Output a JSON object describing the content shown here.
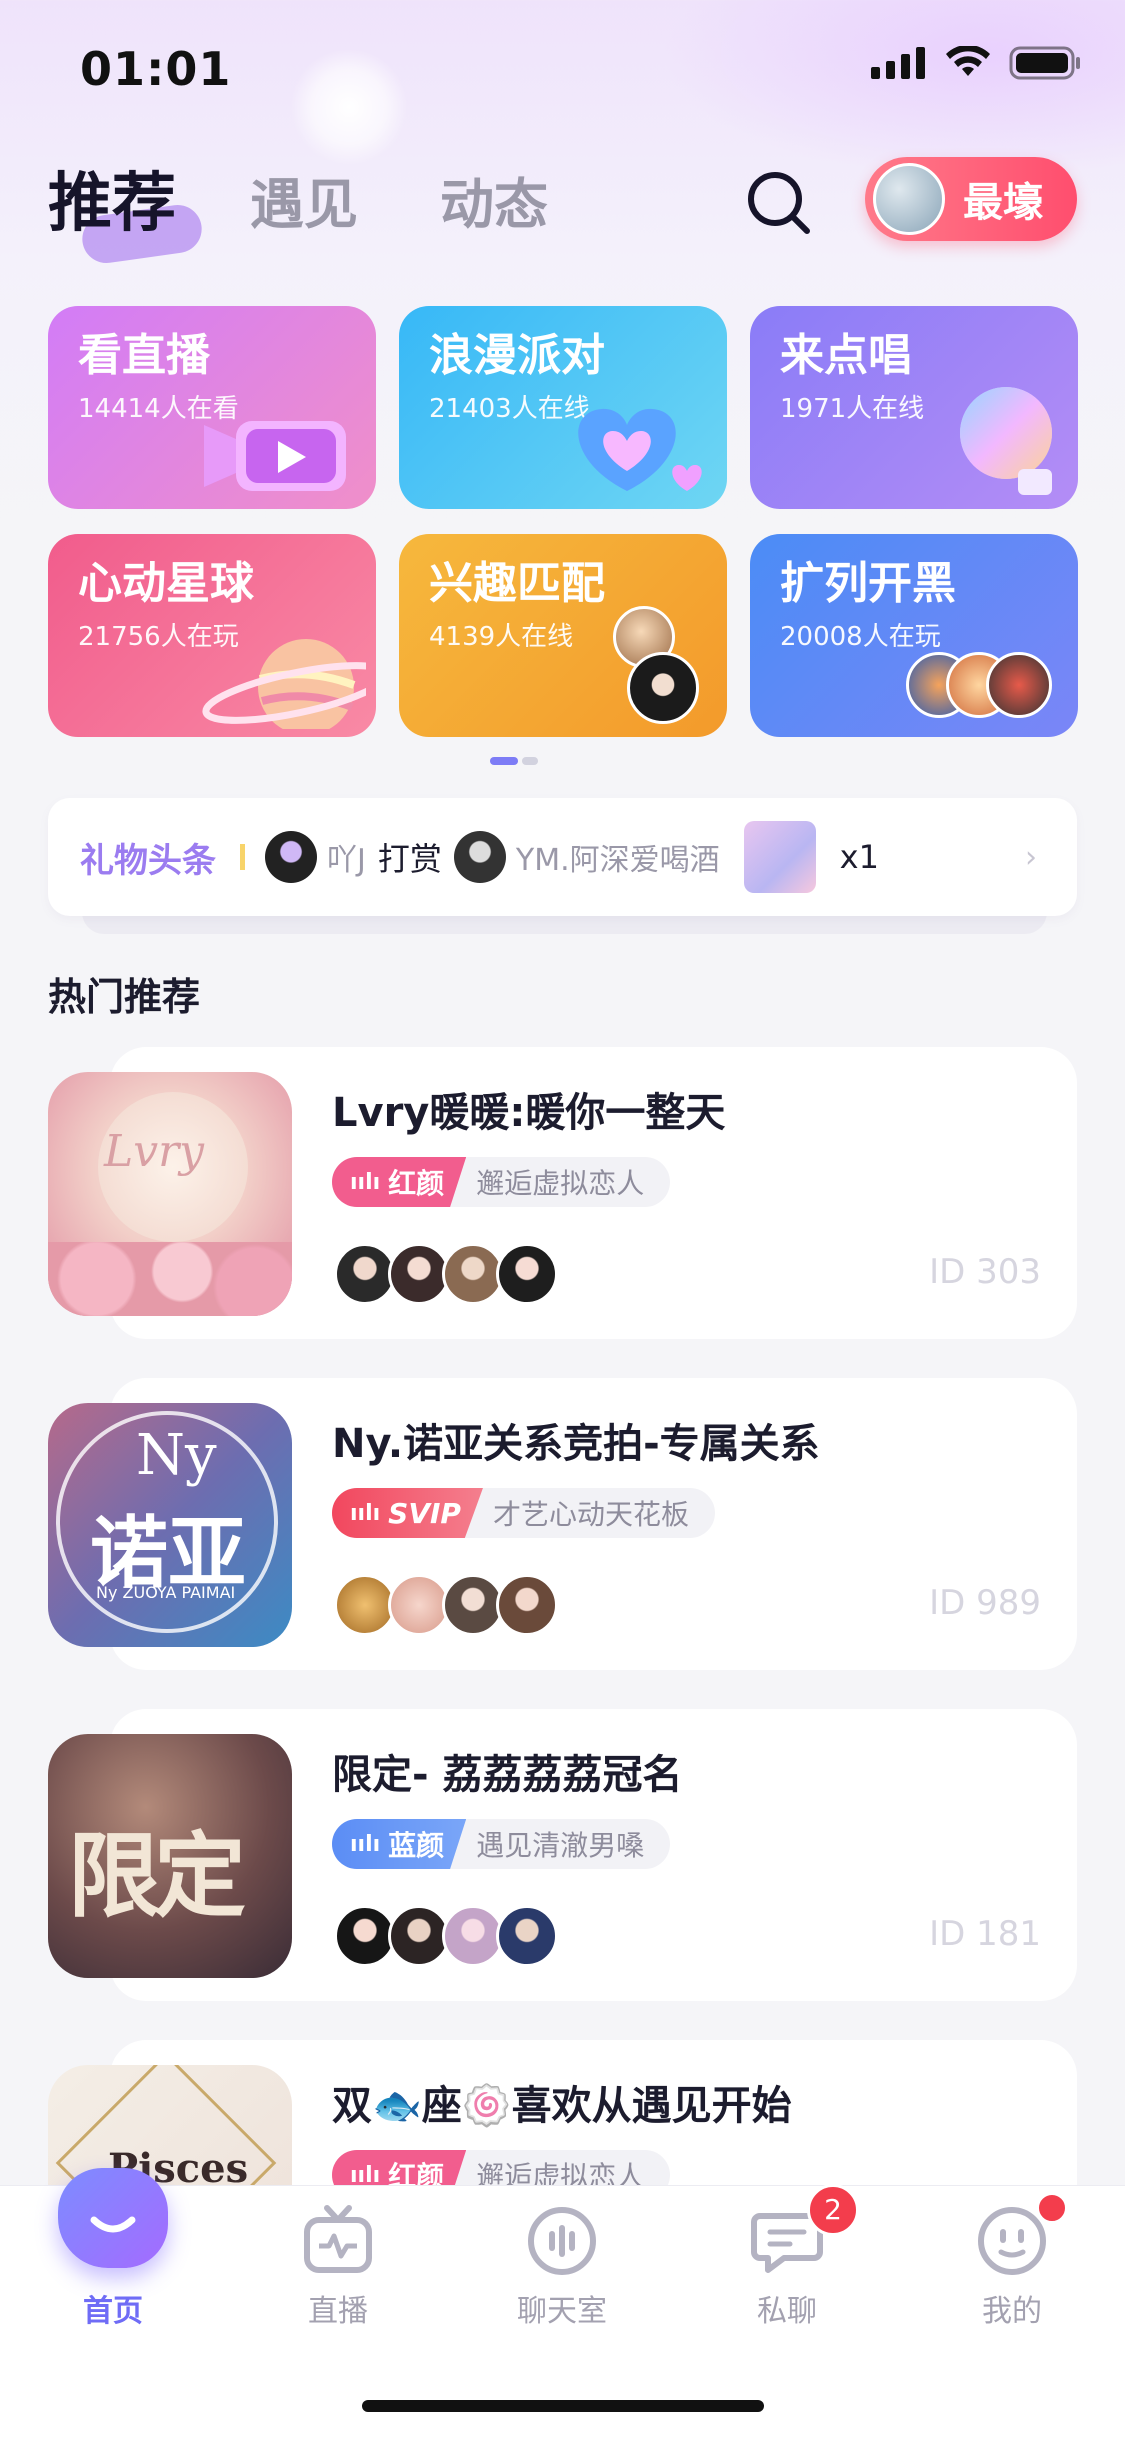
{
  "status_bar": {
    "time": "01:01"
  },
  "header": {
    "tabs": [
      {
        "label": "推荐",
        "active": true
      },
      {
        "label": "遇见",
        "active": false
      },
      {
        "label": "动态",
        "active": false
      }
    ],
    "top_chip_label": "最壕"
  },
  "categories": [
    {
      "title": "看直播",
      "subtitle": "14414人在看",
      "colors": [
        "#d27cf7",
        "#f08fc9"
      ]
    },
    {
      "title": "浪漫派对",
      "subtitle": "21403人在线",
      "colors": [
        "#37b8f7",
        "#6fd6f3"
      ]
    },
    {
      "title": "来点唱",
      "subtitle": "1971人在线",
      "colors": [
        "#8a7cf7",
        "#b48df6"
      ]
    },
    {
      "title": "心动星球",
      "subtitle": "21756人在玩",
      "colors": [
        "#f15c8c",
        "#f98aa5"
      ]
    },
    {
      "title": "兴趣匹配",
      "subtitle": "4139人在线",
      "colors": [
        "#f6b83d",
        "#f39a2b"
      ]
    },
    {
      "title": "扩列开黑",
      "subtitle": "20008人在玩",
      "colors": [
        "#4b8cf6",
        "#7b86f7"
      ]
    }
  ],
  "gift_headline": {
    "label": "礼物头条",
    "sender": "吖J",
    "verb": "打赏",
    "receiver": "YM.阿深爱喝酒",
    "quantity": "x1"
  },
  "section": {
    "title": "热门推荐"
  },
  "rooms": [
    {
      "title": "Lvry暖暖:暖你一整天",
      "badge": "红颜",
      "badge_color": "#f25d8e",
      "tag": "邂逅虚拟恋人",
      "id": "ID 303"
    },
    {
      "title": "Ny.诺亚关系竞拍-专属关系",
      "badge": "SVIP",
      "badge_color": "#f2475e",
      "tag": "才艺心动天花板",
      "id": "ID 989"
    },
    {
      "title": "限定-  荔荔荔荔冠名",
      "badge": "蓝颜",
      "badge_color": "#5b8df5",
      "tag": "遇见清澈男嗓",
      "id": "ID 181"
    },
    {
      "title": "双🐟座🍥喜欢从遇见开始",
      "badge": "红颜",
      "badge_color": "#f25d8e",
      "tag": "邂逅虚拟恋人",
      "id": ""
    }
  ],
  "room_cover_text": {
    "ny_big": "Ny",
    "ny_cn": "诺亚",
    "ny_small": "Ny ZUOYA PAIMAI",
    "lvry": "Lvry",
    "limited": "限定",
    "pisces": "Pisces"
  },
  "bottom_nav": [
    {
      "label": "首页",
      "icon": "home-face-icon",
      "active": true
    },
    {
      "label": "直播",
      "icon": "tv-icon",
      "active": false
    },
    {
      "label": "聊天室",
      "icon": "voice-room-icon",
      "active": false
    },
    {
      "label": "私聊",
      "icon": "chat-bubble-icon",
      "active": false,
      "badge": "2"
    },
    {
      "label": "我的",
      "icon": "profile-face-icon",
      "active": false,
      "dot": true
    }
  ]
}
